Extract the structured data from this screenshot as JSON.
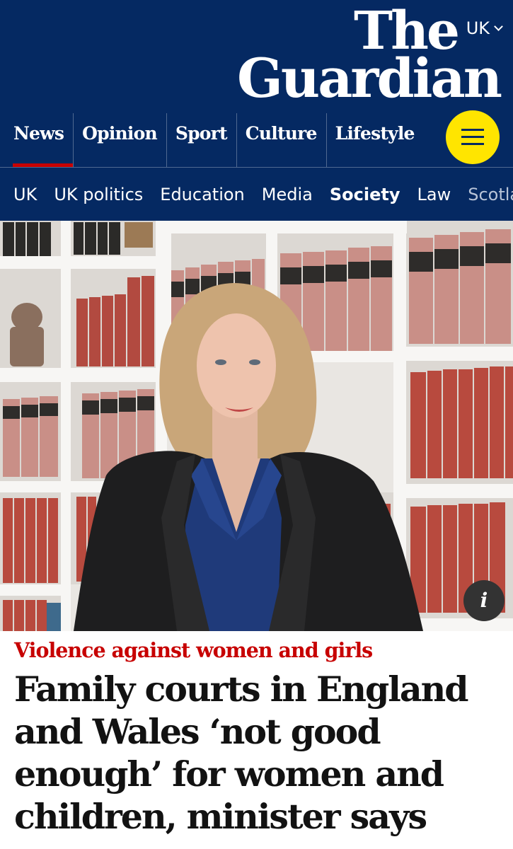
{
  "header": {
    "edition": "UK",
    "logo": {
      "line1": "The",
      "line2": "Guardian"
    },
    "pillars": [
      {
        "label": "News",
        "active": true
      },
      {
        "label": "Opinion",
        "active": false
      },
      {
        "label": "Sport",
        "active": false
      },
      {
        "label": "Culture",
        "active": false
      },
      {
        "label": "Lifestyle",
        "active": false
      }
    ],
    "subnav": [
      "UK",
      "UK politics",
      "Education",
      "Media",
      "Society",
      "Law",
      "Scotland"
    ],
    "subnav_current": "Society",
    "colors": {
      "background": "#052962",
      "menu_button": "#ffe500",
      "active_underline": "#c70000"
    },
    "menu_icon": "hamburger-icon",
    "edition_icon": "chevron-down-icon"
  },
  "hero": {
    "info_label": "i",
    "info_icon": "info-icon"
  },
  "article": {
    "kicker": "Violence against women and girls",
    "headline": "Family courts in England and Wales ‘not good enough’ for women and children, minister says",
    "colors": {
      "kicker": "#c70000",
      "headline": "#121212"
    }
  }
}
